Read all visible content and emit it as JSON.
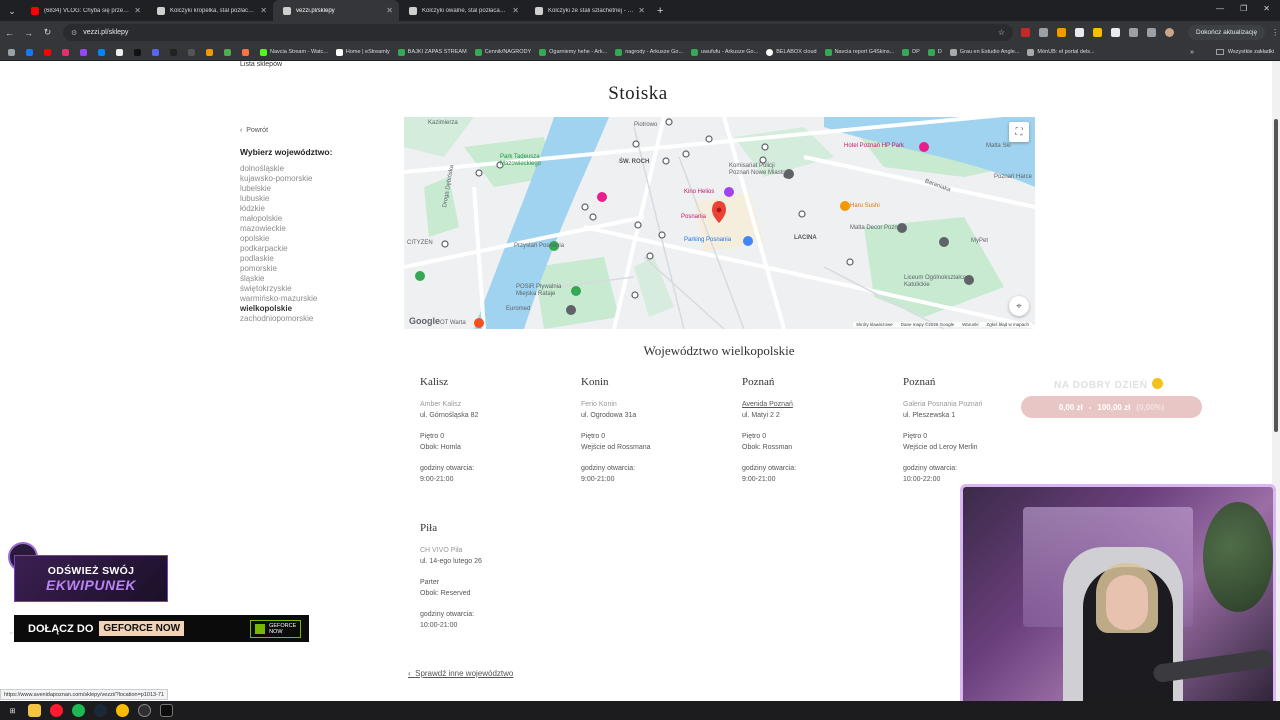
{
  "browser": {
    "tabs": [
      {
        "title": "(6834) VLOG: Chyba się przeliczyła",
        "favicon_color": "#ff0000"
      },
      {
        "title": "Kolczyki kropelka, stal pozłacana",
        "favicon_color": "#cfcfcf"
      },
      {
        "title": "vezzi.pl/sklepy",
        "favicon_color": "#cfcfcf"
      },
      {
        "title": "Kolczyki owalne, stal pozłacana 52",
        "favicon_color": "#cfcfcf"
      },
      {
        "title": "Kolczyki ze stali szlachetnej - lesio",
        "favicon_color": "#cfcfcf"
      }
    ],
    "url": "vezzi.pl/sklepy",
    "update_button": "Dokończ aktualizację",
    "bookmarks": [
      {
        "label": "Navcia Stream - Watc...",
        "color": "#1db954"
      },
      {
        "label": "Home | eStreamly",
        "color": "#ffffff"
      },
      {
        "label": "BAJKI ZAPAS STREAM",
        "color": "#34a853"
      },
      {
        "label": "Cennik/NAGRODY",
        "color": "#34a853"
      },
      {
        "label": "Ogarniemy hehe - Ark...",
        "color": "#34a853"
      },
      {
        "label": "nagrody - Arkusze Go...",
        "color": "#34a853"
      },
      {
        "label": "uwufufu - Arkusze Go...",
        "color": "#34a853"
      },
      {
        "label": "BELABOX cloud",
        "color": "#ffffff"
      },
      {
        "label": "Navcia report G4Skins...",
        "color": "#34a853"
      },
      {
        "label": "DP",
        "color": "#34a853"
      },
      {
        "label": "D",
        "color": "#34a853"
      },
      {
        "label": "Grau en Estudio Angle...",
        "color": "#aaaaaa"
      },
      {
        "label": "MónUB: el portal dels...",
        "color": "#aaaaaa"
      }
    ],
    "all_bookmarks": "Wszystkie zakładki"
  },
  "page": {
    "crumb": "Lista sklepów",
    "title": "Stoiska",
    "back": "Powrót",
    "region_heading": "Wybierz województwo:",
    "regions": [
      "dolnośląskie",
      "kujawsko-pomorskie",
      "lubelskie",
      "lubuskie",
      "łódzkie",
      "małopolskie",
      "mazowieckie",
      "opolskie",
      "podkarpackie",
      "podlaskie",
      "pomorskie",
      "śląskie",
      "świętokrzyskie",
      "warmińsko-mazurskie",
      "wielkopolskie",
      "zachodniopomorskie"
    ],
    "selected_region": "wielkopolskie",
    "voivodeship_title": "Województwo wielkopolskie",
    "check_other": "Sprawdź inne województwo",
    "stores": [
      {
        "city": "Kalisz",
        "mall": "Amber Kalisz",
        "address": "ul. Górnośląska 82",
        "floor": "Piętro 0",
        "near": "Obok: Homla",
        "hours_label": "godziny otwarcia:",
        "hours": "9:00-21:00"
      },
      {
        "city": "Konin",
        "mall": "Ferio Konin",
        "address": "ul. Ogrodowa 31a",
        "floor": "Piętro 0",
        "near": "Wejście od Rossmana",
        "hours_label": "godziny otwarcia:",
        "hours": "9:00-21:00"
      },
      {
        "city": "Poznań",
        "mall": "Avenida Poznań",
        "address": "ul. Matyi 2 2",
        "floor": "Piętro 0",
        "near": "Obok: Rossman",
        "hours_label": "godziny otwarcia:",
        "hours": "9:00-21:00"
      },
      {
        "city": "Poznań",
        "mall": "Galeria Posnania Poznań",
        "address": "ul. Pleszewska 1",
        "floor": "Piętro 0",
        "near": "Wejście od Leroy Merlin",
        "hours_label": "godziny otwarcia:",
        "hours": "10:00-22:00"
      },
      {
        "city": "Piła",
        "mall": "CH VIVO Piła",
        "address": "ul. 14-ego lutego 26",
        "floor": "Parter",
        "near": "Obok: Reserved",
        "hours_label": "godziny otwarcia:",
        "hours": "10:00-21:00"
      }
    ]
  },
  "map": {
    "labels": {
      "kazimierza": "Kazimierza",
      "piotrowo": "Piotrowo",
      "sw_roch": "ŚW. ROCH",
      "park_tadeusza": "Park Tadeusza Mazowieckiego",
      "komisariat": "Komisariat Policji Poznań Nowe Miasto",
      "kino_helios": "Kino Helios",
      "posnania": "Posnania",
      "parking": "Parking Posnania",
      "haru_sushi": "Haru Sushi",
      "hotel": "Hotel Poznań HP Park",
      "malta_ski": "Malta Ski",
      "poznan_harce": "Poznań Harce",
      "baraniaka": "Baraniaka",
      "lacina": "LACINA",
      "malta_decor": "Malta Decor Poznań",
      "mypet": "MyPet",
      "przystan": "Przystań Posnania",
      "cityzen": "CITYZEN",
      "posir": "POSiR Pływalnia Miejska Rataje",
      "euromed": "Euromed",
      "liceum": "Liceum Ogólnokształcące Katolickie",
      "ot_warta": "OT Warta",
      "dolny_debinski": "Droga Dębińska"
    },
    "footer": [
      "Skróty klawiszowe",
      "Dane mapy ©2026 Google",
      "Warunki",
      "Zgłoś błąd w mapach"
    ],
    "logo": "Google"
  },
  "overlay": {
    "greeting": "NA DOBRY DZIEŃ",
    "goal_current": "0,00 zł",
    "goal_target": "100,00 zł",
    "goal_percent": "(0,00%)",
    "promo1_line1": "ODŚWIEŻ SWÓJ",
    "promo1_line2": "EKWIPUNEK",
    "promo2_join": "DOŁĄCZ DO",
    "promo2_brand": "GEFORCE NOW",
    "promo2_nv_line1": "GEFORCE",
    "promo2_nv_line2": "NOW"
  },
  "status_url": "https://www.avenidapoznan.com/sklepy/vezzi/?location=p1013-71",
  "colors": {
    "text_dark": "#222222",
    "text_muted": "#999999",
    "map_water": "#9fd3f0",
    "map_park": "#c7ead1",
    "pin_red": "#ea4335"
  }
}
